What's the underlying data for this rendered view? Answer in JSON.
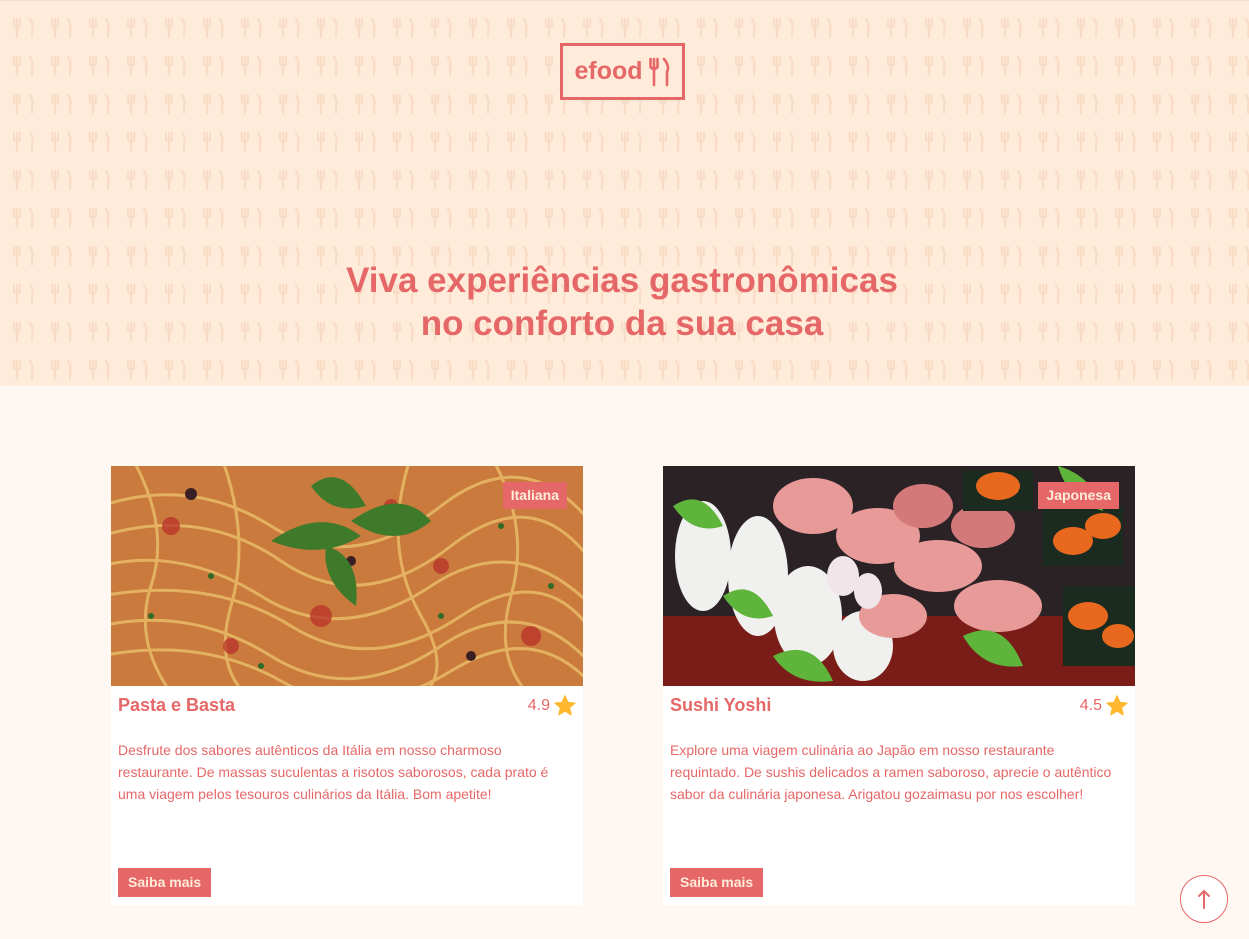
{
  "brand": {
    "logo_text": "efood",
    "logo_icon": "fork-knife-icon"
  },
  "hero": {
    "title_line1": "Viva experiências gastronômicas",
    "title_line2": "no conforto da sua casa"
  },
  "colors": {
    "primary": "#e66767",
    "hero_bg": "#ffebd9",
    "page_bg": "#fff8f2",
    "star": "#ffb930"
  },
  "restaurants": [
    {
      "name": "Pasta e Basta",
      "tag": "Italiana",
      "rating": "4.9",
      "description": "Desfrute dos sabores autênticos da Itália em nosso charmoso restaurante. De massas suculentas a risotos saborosos, cada prato é uma viagem pelos tesouros culinários da Itália. Bom apetite!",
      "button": "Saiba mais"
    },
    {
      "name": "Sushi Yoshi",
      "tag": "Japonesa",
      "rating": "4.5",
      "description": "Explore uma viagem culinária ao Japão em nosso restaurante requintado. De sushis delicados a ramen saboroso, aprecie o autêntico sabor da culinária japonesa. Arigatou gozaimasu por nos escolher!",
      "button": "Saiba mais"
    }
  ],
  "scroll_top": {
    "icon": "arrow-up-icon"
  }
}
